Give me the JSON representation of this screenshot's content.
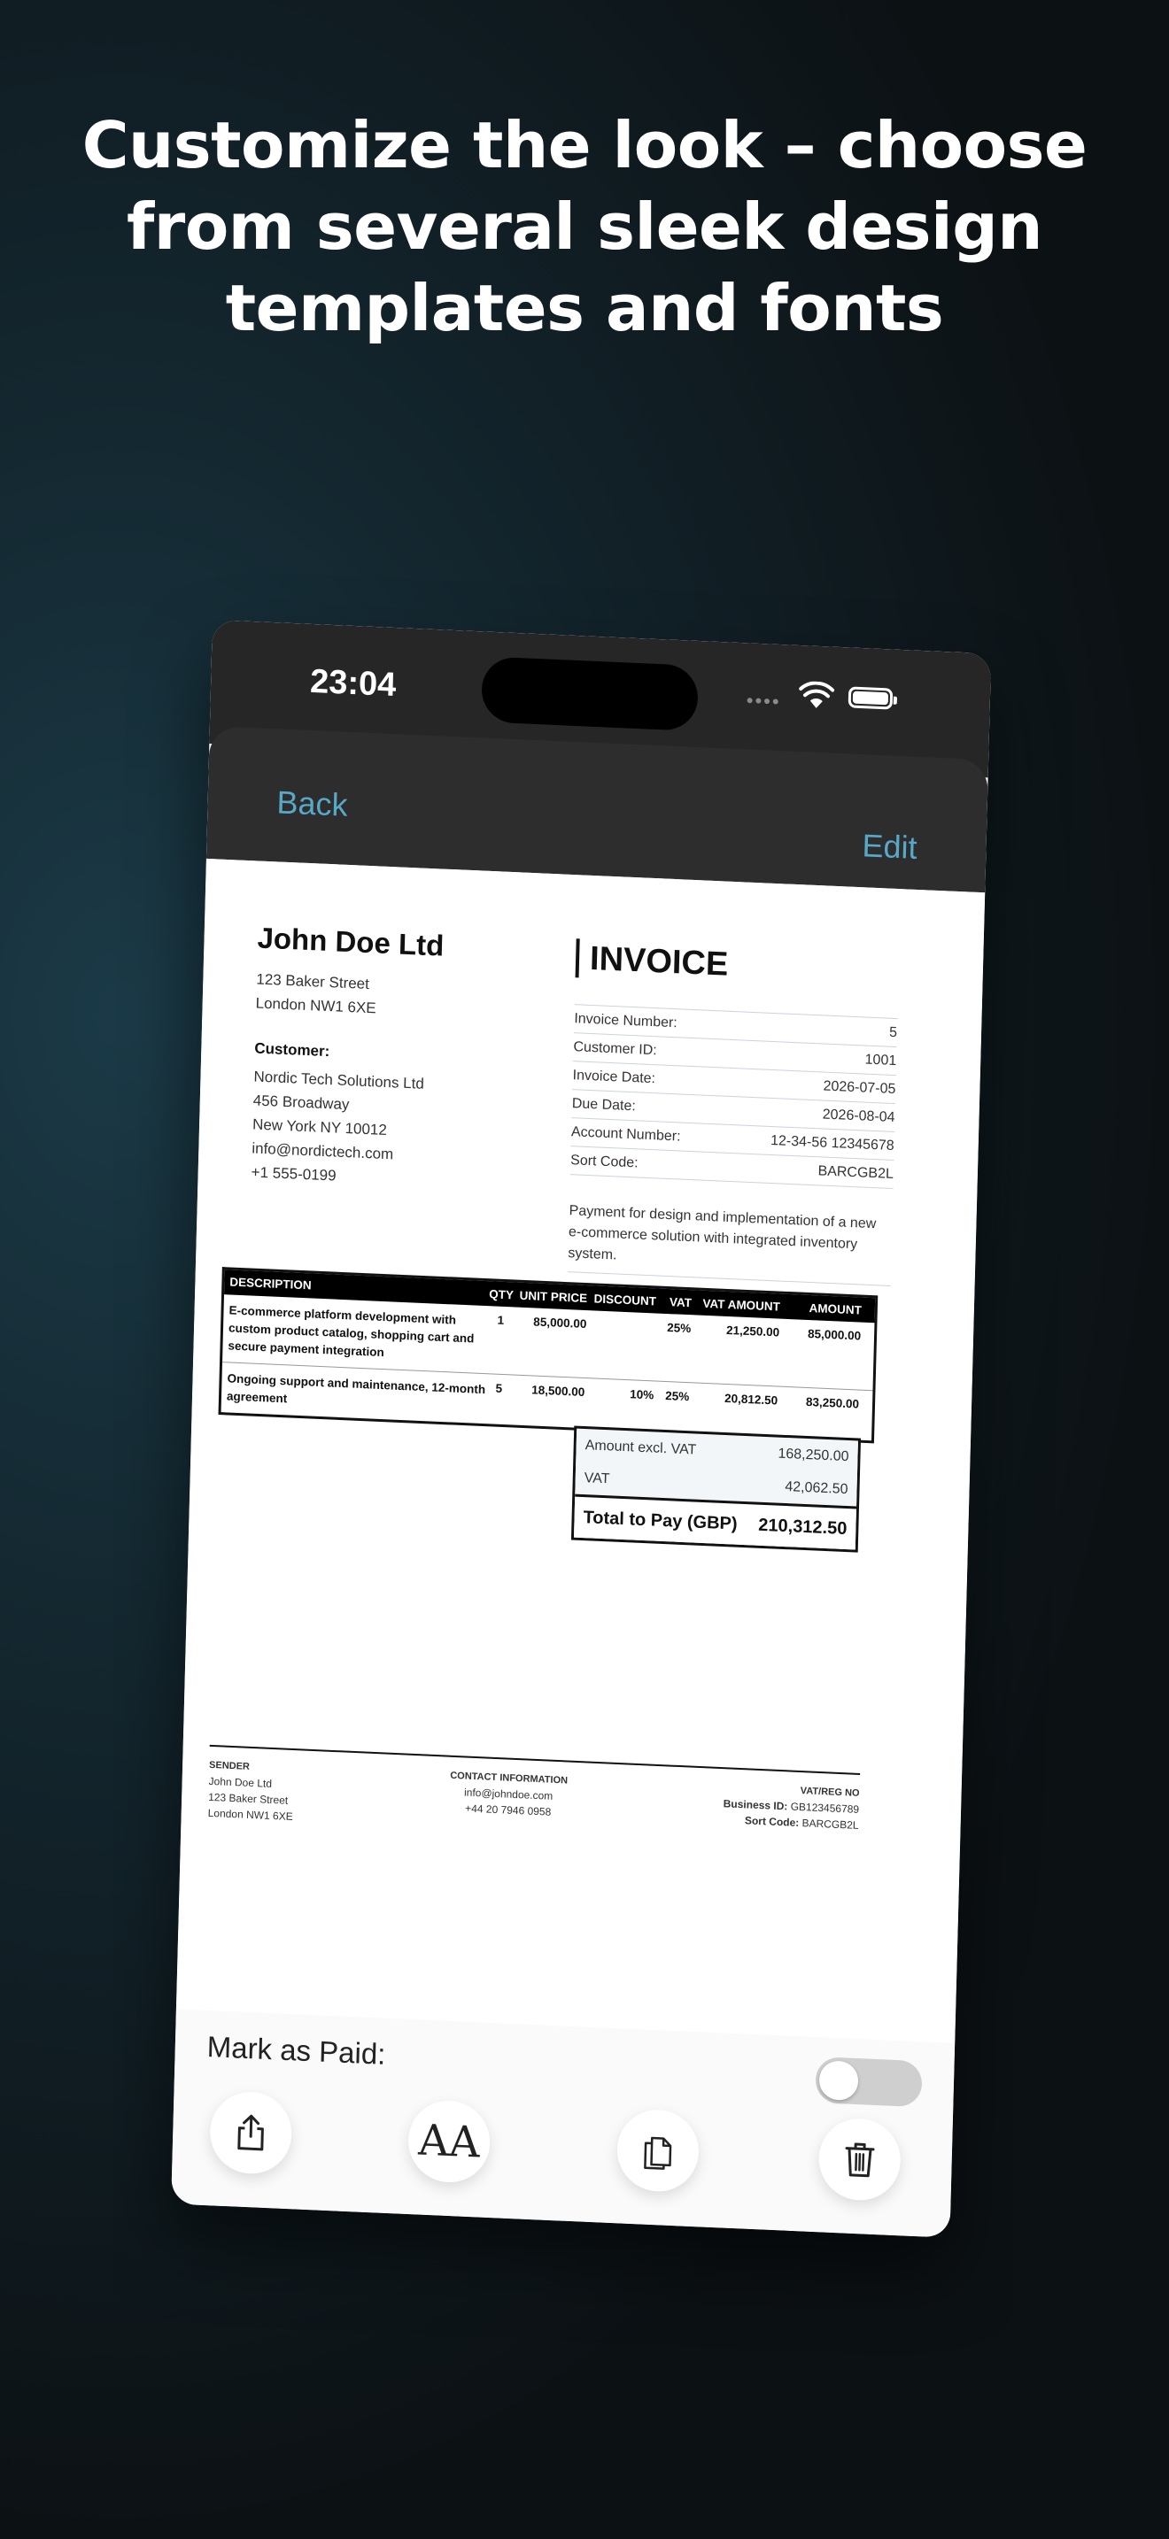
{
  "headline": "Customize the look – choose from several sleek design templates and fonts",
  "status": {
    "time": "23:04"
  },
  "nav": {
    "back_label": "Back",
    "edit_label": "Edit"
  },
  "invoice": {
    "company": "John Doe Ltd",
    "company_address": [
      "123 Baker Street",
      "London NW1 6XE"
    ],
    "customer_label": "Customer:",
    "customer": [
      "Nordic Tech Solutions Ltd",
      "456 Broadway",
      "New York NY 10012",
      "info@nordictech.com",
      "+1 555-0199"
    ],
    "title": "INVOICE",
    "meta": [
      {
        "label": "Invoice Number:",
        "value": "5"
      },
      {
        "label": "Customer ID:",
        "value": "1001"
      },
      {
        "label": "Invoice Date:",
        "value": "2026-07-05"
      },
      {
        "label": "Due Date:",
        "value": "2026-08-04"
      },
      {
        "label": "Account Number:",
        "value": "12-34-56 12345678"
      },
      {
        "label": "Sort Code:",
        "value": "BARCGB2L"
      }
    ],
    "description": "Payment for design and implementation of a new e-commerce solution with integrated inventory system.",
    "items_header": [
      "DESCRIPTION",
      "QTY",
      "UNIT PRICE",
      "DISCOUNT",
      "VAT",
      "VAT AMOUNT",
      "AMOUNT"
    ],
    "items": [
      {
        "desc": "E-commerce platform development with custom product catalog, shopping cart and secure payment integration",
        "qty": "1",
        "unit": "85,000.00",
        "discount": "",
        "vat": "25%",
        "vat_amount": "21,250.00",
        "amount": "85,000.00"
      },
      {
        "desc": "Ongoing support and maintenance, 12-month agreement",
        "qty": "5",
        "unit": "18,500.00",
        "discount": "10%",
        "vat": "25%",
        "vat_amount": "20,812.50",
        "amount": "83,250.00"
      }
    ],
    "totals": {
      "excl_label": "Amount excl. VAT",
      "excl_value": "168,250.00",
      "vat_label": "VAT",
      "vat_value": "42,062.50",
      "total_label": "Total to Pay (GBP)",
      "total_value": "210,312.50"
    },
    "footer": {
      "sender_label": "SENDER",
      "sender": [
        "John Doe Ltd",
        "123 Baker Street",
        "London NW1 6XE"
      ],
      "contact_label": "CONTACT INFORMATION",
      "contact": [
        "info@johndoe.com",
        "+44 20 7946 0958"
      ],
      "vat_label": "VAT/REG NO",
      "business_id_label": "Business ID:",
      "business_id": "GB123456789",
      "sort_code_label": "Sort Code:",
      "sort_code": "BARCGB2L"
    }
  },
  "bottom": {
    "paid_label": "Mark as Paid:",
    "paid": false,
    "fonts_glyph": "AA",
    "icons": [
      "share-icon",
      "font-icon",
      "copy-icon",
      "trash-icon"
    ]
  }
}
